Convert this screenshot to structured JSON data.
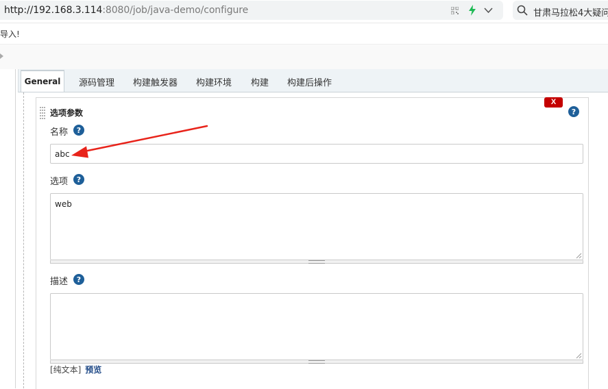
{
  "browser": {
    "url_host": "http://192.168.3.114",
    "url_rest": ":8080/job/java-demo/configure",
    "search_text": "甘肃马拉松4大疑问",
    "icons": [
      "qr-code-icon",
      "bolt-icon",
      "chevron-down-icon",
      "search-icon"
    ]
  },
  "notice": {
    "text": "导入!"
  },
  "tabs": [
    {
      "label": "General",
      "active": true
    },
    {
      "label": "源码管理"
    },
    {
      "label": "构建触发器"
    },
    {
      "label": "构建环境"
    },
    {
      "label": "构建"
    },
    {
      "label": "构建后操作"
    }
  ],
  "param": {
    "title": "选项参数",
    "delete_label": "X",
    "name_label": "名称",
    "name_value": "abc",
    "choices_label": "选项",
    "choices_value": "web",
    "description_label": "描述",
    "description_value": "",
    "format_label": "[纯文本]",
    "preview_label": "预览"
  },
  "colors": {
    "help_blue": "#1e5f99",
    "delete_red": "#c40000",
    "arrow_red": "#e8231a",
    "link_blue": "#204a87"
  }
}
